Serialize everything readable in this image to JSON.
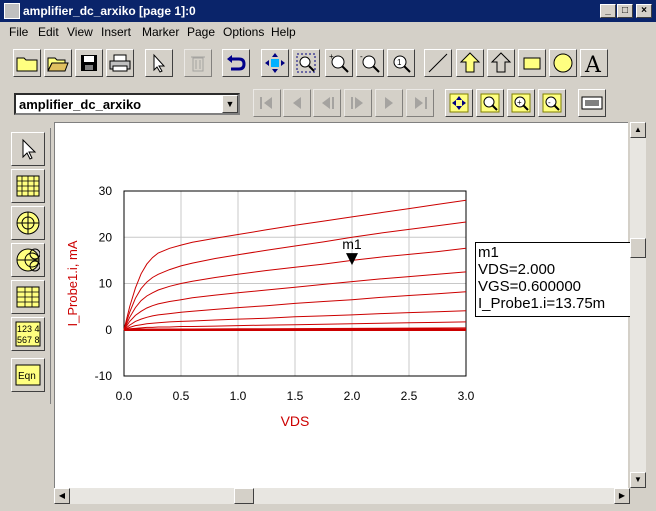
{
  "window": {
    "title": "amplifier_dc_arxiko [page 1]:0",
    "minimize": "_",
    "maximize": "□",
    "close": "×"
  },
  "menu": [
    "File",
    "Edit",
    "View",
    "Insert",
    "Marker",
    "Page",
    "Options",
    "Help"
  ],
  "toolbar1": [
    "open-folder-icon",
    "open-file-icon",
    "save-icon",
    "print-icon",
    "pointer-icon",
    "delete-icon",
    "undo-icon",
    "move-icon",
    "zoom-area-icon",
    "zoom-in-icon",
    "zoom-out-icon",
    "zoom-icon",
    "line-icon",
    "polygon-icon",
    "polyline-icon",
    "rectangle-icon",
    "circle-icon",
    "text-icon"
  ],
  "dataset": {
    "selected": "amplifier_dc_arxiko"
  },
  "toolbar2": [
    "first-page-icon",
    "prev-page-icon",
    "prev-icon",
    "next-icon",
    "next-page-icon",
    "last-page-icon",
    "view-all-icon",
    "zoom-window-icon",
    "zoom-in-view-icon",
    "zoom-out-view-icon",
    "equation-settings-icon"
  ],
  "palette": {
    "items": [
      "pointer-icon",
      "rectangular-plot-icon",
      "polar-plot-icon",
      "smith-chart-icon",
      "list-icon",
      "stack-icon",
      "equation-icon"
    ],
    "stack_text": "123 4 567 8",
    "eqn_text": "Eqn"
  },
  "marker": {
    "label": "m1",
    "lines": [
      "m1",
      "VDS=2.000",
      "VGS=0.600000",
      "I_Probe1.i=13.75m"
    ]
  },
  "chart_data": {
    "type": "line",
    "xlabel": "VDS",
    "ylabel": "I_Probe1.i, mA",
    "xlim": [
      0,
      3
    ],
    "ylim": [
      -10,
      30
    ],
    "xticks": [
      "0.0",
      "0.5",
      "1.0",
      "1.5",
      "2.0",
      "2.5",
      "3.0"
    ],
    "yticks": [
      "-10",
      "0",
      "10",
      "20",
      "30"
    ],
    "grid": true,
    "color": "#cc0000",
    "x": [
      0,
      0.05,
      0.1,
      0.15,
      0.2,
      0.25,
      0.3,
      0.4,
      0.5,
      0.6,
      0.8,
      1.0,
      1.25,
      1.5,
      1.75,
      2.0,
      2.25,
      2.5,
      2.75,
      3.0
    ],
    "series": [
      {
        "values": [
          0,
          5.0,
          9.0,
          12.1,
          14.2,
          15.6,
          16.6,
          17.6,
          18.3,
          18.9,
          19.8,
          20.6,
          21.6,
          22.6,
          23.5,
          24.4,
          25.3,
          26.2,
          27.1,
          28.0
        ]
      },
      {
        "values": [
          0,
          3.8,
          6.8,
          8.9,
          10.3,
          11.3,
          12.0,
          13.0,
          13.8,
          14.4,
          15.4,
          16.2,
          17.2,
          18.1,
          19.0,
          20.0,
          20.9,
          21.7,
          22.5,
          23.3
        ]
      },
      {
        "values": [
          0,
          2.7,
          4.8,
          6.3,
          7.3,
          8.0,
          8.6,
          9.4,
          10.0,
          10.5,
          11.3,
          12.0,
          12.8,
          13.5,
          14.2,
          15.0,
          15.7,
          16.3,
          16.9,
          17.6
        ]
      },
      {
        "values": [
          0,
          1.8,
          3.1,
          4.0,
          4.7,
          5.2,
          5.6,
          6.1,
          6.5,
          6.9,
          7.5,
          8.0,
          8.6,
          9.2,
          9.8,
          10.4,
          11.0,
          11.5,
          12.0,
          12.5
        ]
      },
      {
        "values": [
          0,
          1.0,
          1.8,
          2.3,
          2.7,
          3.0,
          3.2,
          3.5,
          3.8,
          4.0,
          4.4,
          4.8,
          5.2,
          5.7,
          6.1,
          6.5,
          7.0,
          7.4,
          7.8,
          8.2
        ]
      },
      {
        "values": [
          0,
          0.5,
          0.9,
          1.1,
          1.3,
          1.4,
          1.5,
          1.7,
          1.8,
          1.9,
          2.1,
          2.3,
          2.5,
          2.8,
          3.0,
          3.2,
          3.5,
          3.7,
          3.9,
          4.1
        ]
      },
      {
        "values": [
          0,
          0.2,
          0.3,
          0.4,
          0.5,
          0.5,
          0.6,
          0.6,
          0.7,
          0.7,
          0.8,
          0.9,
          1.0,
          1.1,
          1.2,
          1.3,
          1.4,
          1.5,
          1.6,
          1.7
        ]
      },
      {
        "values": [
          0,
          0.05,
          0.08,
          0.1,
          0.12,
          0.13,
          0.14,
          0.15,
          0.16,
          0.17,
          0.19,
          0.2,
          0.22,
          0.25,
          0.27,
          0.3,
          0.32,
          0.35,
          0.37,
          0.4
        ]
      },
      {
        "values": [
          0,
          0.01,
          0.02,
          0.02,
          0.03,
          0.03,
          0.03,
          0.03,
          0.04,
          0.04,
          0.04,
          0.05,
          0.05,
          0.06,
          0.06,
          0.07,
          0.07,
          0.08,
          0.08,
          0.09
        ]
      },
      {
        "values": [
          0,
          0,
          0,
          0,
          0,
          0,
          0,
          0,
          0,
          0,
          0,
          0,
          0,
          0,
          0,
          0,
          0,
          0,
          0,
          0
        ]
      }
    ],
    "marker": {
      "x": 2.0,
      "y": 13.75
    }
  }
}
